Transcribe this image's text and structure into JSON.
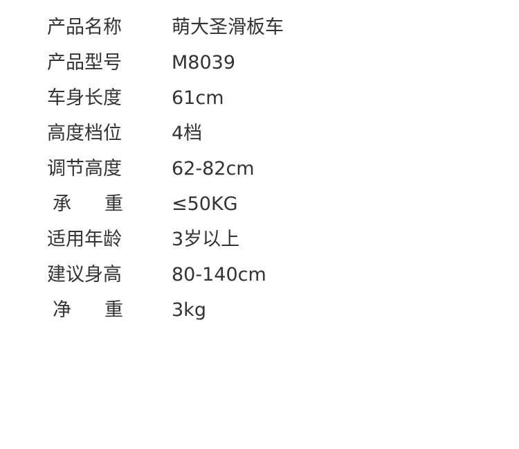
{
  "specs": [
    {
      "label": "产品名称",
      "value": "萌大圣滑板车",
      "spaced": false
    },
    {
      "label": "产品型号",
      "value": "M8039",
      "spaced": false
    },
    {
      "label": "车身长度",
      "value": "61cm",
      "spaced": false
    },
    {
      "label": "高度档位",
      "value": "4档",
      "spaced": false
    },
    {
      "label": "调节高度",
      "value": "62-82cm",
      "spaced": false
    },
    {
      "label": "承重",
      "value": "≤50KG",
      "spaced": true
    },
    {
      "label": "适用年龄",
      "value": "3岁以上",
      "spaced": false
    },
    {
      "label": "建议身高",
      "value": "80-140cm",
      "spaced": false
    },
    {
      "label": "净重",
      "value": "3kg",
      "spaced": true
    }
  ]
}
